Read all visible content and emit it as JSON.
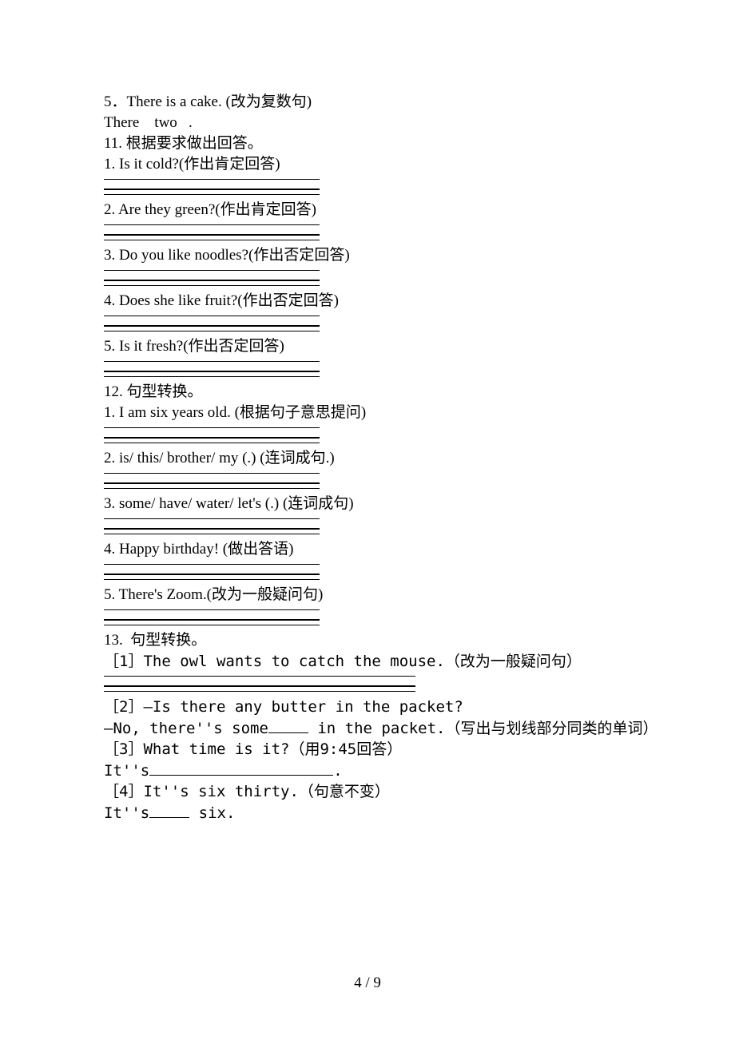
{
  "q5": {
    "prompt": "5．There is a cake. (改为复数句)",
    "answer_template": "There    two   ."
  },
  "q11": {
    "header": "11. 根据要求做出回答。",
    "items": [
      "1. Is it cold?(作出肯定回答)",
      "2. Are they green?(作出肯定回答)",
      "3. Do you like noodles?(作出否定回答)",
      "4. Does she like fruit?(作出否定回答)",
      "5. Is it fresh?(作出否定回答)"
    ]
  },
  "q12": {
    "header": "12. 句型转换。",
    "items": [
      "1. I am six years old. (根据句子意思提问)",
      "2. is/ this/ brother/ my (.) (连词成句.)",
      "3. some/ have/ water/ let's (.) (连词成句)",
      "4. Happy birthday! (做出答语)",
      "5. There's Zoom.(改为一般疑问句)"
    ]
  },
  "q13": {
    "header": "13.  句型转换。",
    "item1": "［1］The owl wants to catch the mouse.（改为一般疑问句）",
    "item2a": "［2］—Is there any butter in the packet?",
    "item2b_pre": "—No, there''s some",
    "item2b_post": " in the packet.（写出与划线部分同类的单词）",
    "item3": "［3］What time is it?（用9:45回答）",
    "item3_ans_pre": "It''s",
    "item3_ans_post": ".",
    "item4": "［4］It''s six thirty.（句意不变）",
    "item4_ans_pre": "It''s",
    "item4_ans_post": " six."
  },
  "footer": "4 / 9"
}
